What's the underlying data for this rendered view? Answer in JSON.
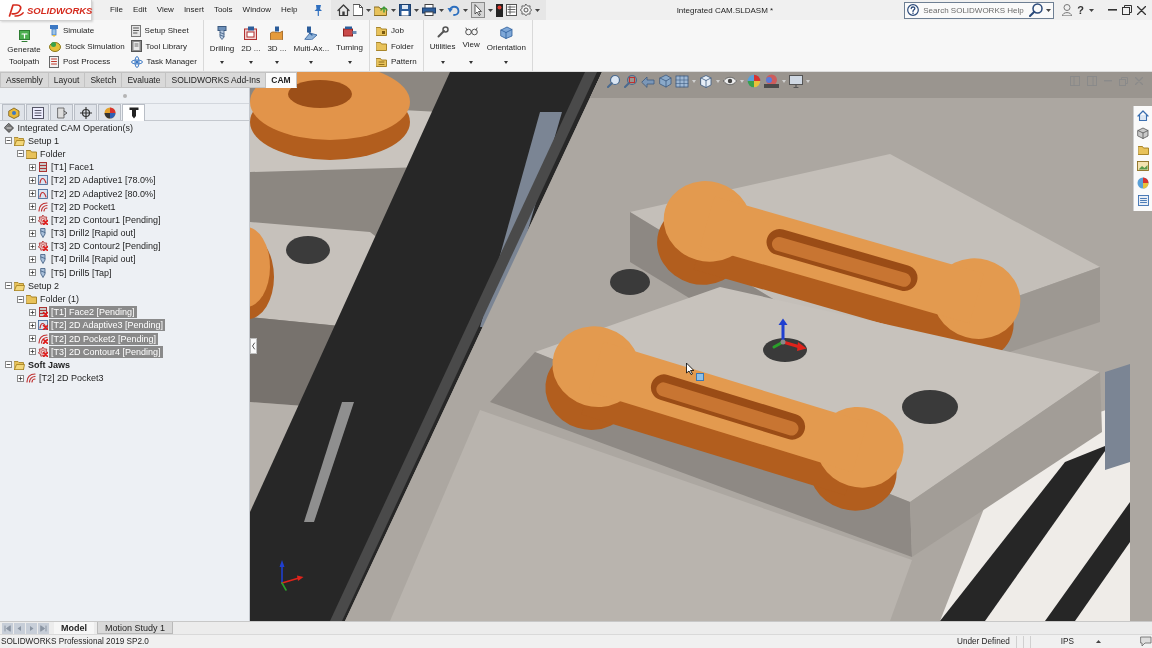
{
  "title_bar": {
    "logo": "SOLIDWORKS",
    "menu": [
      "File",
      "Edit",
      "View",
      "Insert",
      "Tools",
      "Window",
      "Help"
    ],
    "document_title": "Integrated CAM.SLDASM *",
    "search": {
      "placeholder": "Search SOLIDWORKS Help"
    },
    "help_label": "?"
  },
  "ribbon": {
    "sections": [
      [
        {
          "kind": "large",
          "buttons": [
            {
              "label": "Generate Toolpath",
              "dropdown": false
            }
          ]
        },
        {
          "kind": "stack",
          "buttons": [
            {
              "label": "Simulate"
            },
            {
              "label": "Stock Simulation"
            },
            {
              "label": "Post Process"
            }
          ]
        },
        {
          "kind": "stack",
          "buttons": [
            {
              "label": "Setup Sheet"
            },
            {
              "label": "Tool Library"
            },
            {
              "label": "Task Manager"
            }
          ]
        }
      ],
      [
        {
          "kind": "large",
          "buttons": [
            {
              "label": "Drilling",
              "dropdown": true
            },
            {
              "label": "2D ...",
              "dropdown": true
            },
            {
              "label": "3D ...",
              "dropdown": true
            },
            {
              "label": "Multi-Ax...",
              "dropdown": true
            },
            {
              "label": "Turning",
              "dropdown": true
            }
          ]
        }
      ],
      [
        {
          "kind": "stack",
          "buttons": [
            {
              "label": "Job"
            },
            {
              "label": "Folder"
            },
            {
              "label": "Pattern"
            }
          ]
        }
      ],
      [
        {
          "kind": "large",
          "buttons": [
            {
              "label": "Utilities",
              "dropdown": true
            },
            {
              "label": "View",
              "dropdown": true
            },
            {
              "label": "Orientation",
              "dropdown": true
            }
          ]
        }
      ]
    ]
  },
  "command_tabs": [
    {
      "label": "Assembly",
      "selected": false
    },
    {
      "label": "Layout",
      "selected": false
    },
    {
      "label": "Sketch",
      "selected": false
    },
    {
      "label": "Evaluate",
      "selected": false
    },
    {
      "label": "SOLIDWORKS Add-Ins",
      "selected": false
    },
    {
      "label": "CAM",
      "selected": true
    }
  ],
  "feature_manager": {
    "tabs": [
      {
        "selected": false
      },
      {
        "selected": false
      },
      {
        "selected": false
      },
      {
        "selected": false
      },
      {
        "selected": false
      },
      {
        "selected": true
      }
    ],
    "tree": {
      "label": "Integrated CAM Operation(s)",
      "kind": "root",
      "children": [
        {
          "label": "Setup 1",
          "kind": "setup",
          "expanded": true,
          "selected": false,
          "emphasized": false,
          "children": [
            {
              "label": "Folder",
              "kind": "folder",
              "expanded": true,
              "selected": false,
              "children": [
                {
                  "label": "[T1] Face1",
                  "kind": "face",
                  "expanded": false,
                  "selected": false,
                  "flagged": false
                },
                {
                  "label": "[T2] 2D Adaptive1 [78.0%]",
                  "kind": "adaptive",
                  "expanded": false,
                  "selected": false,
                  "flagged": false
                },
                {
                  "label": "[T2] 2D Adaptive2 [80.0%]",
                  "kind": "adaptive",
                  "expanded": false,
                  "selected": false,
                  "flagged": false
                },
                {
                  "label": "[T2] 2D Pocket1",
                  "kind": "pocket",
                  "expanded": false,
                  "selected": false,
                  "flagged": false
                },
                {
                  "label": "[T2] 2D Contour1 [Pending]",
                  "kind": "contour",
                  "expanded": false,
                  "selected": false,
                  "flagged": true
                },
                {
                  "label": "[T3] Drill2 [Rapid out]",
                  "kind": "drill",
                  "expanded": false,
                  "selected": false,
                  "flagged": false
                },
                {
                  "label": "[T3] 2D Contour2 [Pending]",
                  "kind": "contour",
                  "expanded": false,
                  "selected": false,
                  "flagged": true
                },
                {
                  "label": "[T4] Drill4 [Rapid out]",
                  "kind": "drill",
                  "expanded": false,
                  "selected": false,
                  "flagged": false
                },
                {
                  "label": "[T5] Drill5 [Tap]",
                  "kind": "drill",
                  "expanded": false,
                  "selected": false,
                  "flagged": false
                }
              ]
            }
          ]
        },
        {
          "label": "Setup 2",
          "kind": "setup",
          "expanded": true,
          "selected": false,
          "emphasized": false,
          "children": [
            {
              "label": "Folder (1)",
              "kind": "folder",
              "expanded": true,
              "selected": false,
              "children": [
                {
                  "label": "[T1] Face2 [Pending]",
                  "kind": "face",
                  "expanded": false,
                  "selected": true,
                  "flagged": true
                },
                {
                  "label": "[T2] 2D Adaptive3 [Pending]",
                  "kind": "adaptive",
                  "expanded": false,
                  "selected": true,
                  "flagged": true
                },
                {
                  "label": "[T2] 2D Pocket2 [Pending]",
                  "kind": "pocket",
                  "expanded": false,
                  "selected": true,
                  "flagged": true
                },
                {
                  "label": "[T3] 2D Contour4 [Pending]",
                  "kind": "contour",
                  "expanded": false,
                  "selected": true,
                  "flagged": true
                }
              ]
            }
          ]
        },
        {
          "label": "Soft Jaws",
          "kind": "setup",
          "expanded": true,
          "selected": false,
          "emphasized": true,
          "children": [
            {
              "label": "[T2] 2D Pocket3",
              "kind": "pocket",
              "expanded": false,
              "selected": false,
              "flagged": false
            }
          ]
        }
      ]
    }
  },
  "bottom_tabs": [
    {
      "label": "Model",
      "selected": true
    },
    {
      "label": "Motion Study 1",
      "selected": false
    }
  ],
  "status_bar": {
    "product": "SOLIDWORKS Professional 2019 SP2.0",
    "sketch_status": "Under Defined",
    "units": "IPS"
  }
}
